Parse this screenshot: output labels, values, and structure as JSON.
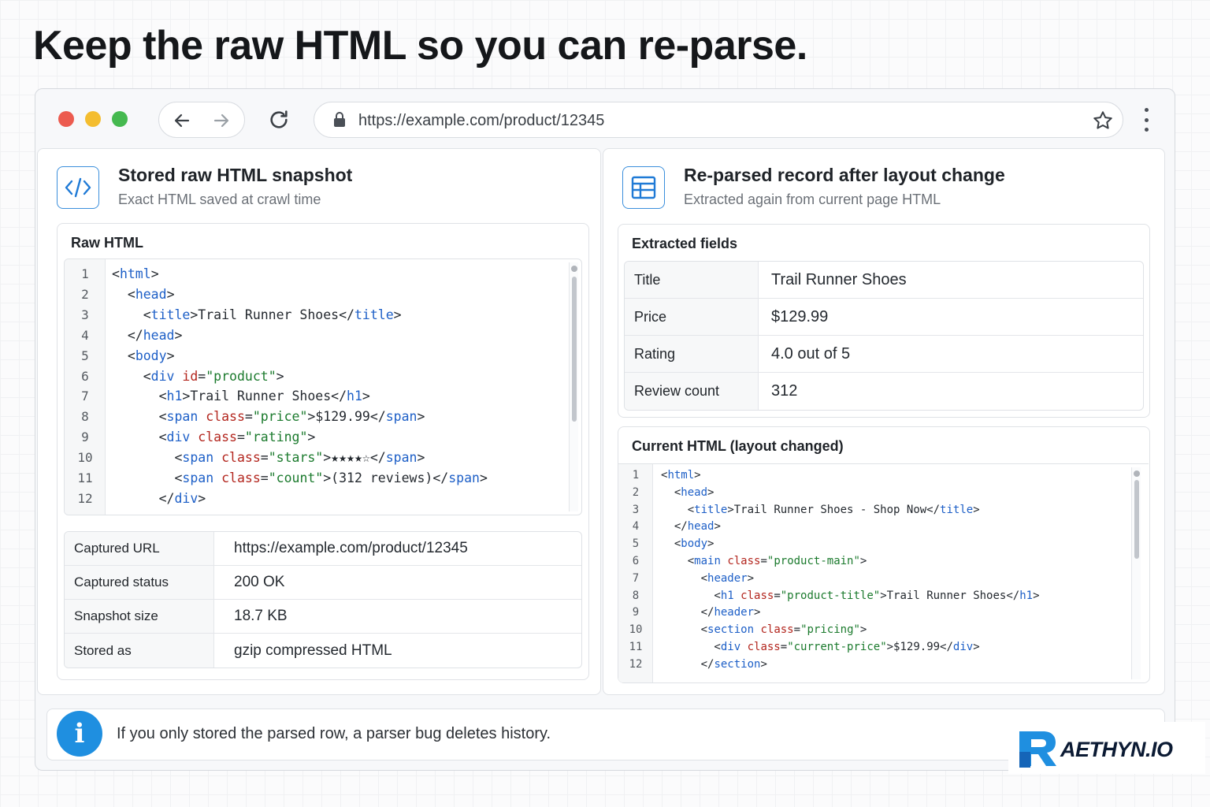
{
  "headline": "Keep the raw HTML so you can re-parse.",
  "browser": {
    "url": "https://example.com/product/12345",
    "icons": [
      "back-arrow-icon",
      "forward-arrow-icon",
      "reload-icon",
      "lock-icon",
      "star-icon",
      "more-vertical-icon"
    ]
  },
  "left_panel": {
    "title": "Stored raw HTML snapshot",
    "subtitle": "Exact HTML saved at crawl time",
    "code_title": "Raw HTML",
    "code_lines": [
      {
        "n": "1",
        "html": "<span>&lt;</span><span class=\"t\">html</span><span>&gt;</span>"
      },
      {
        "n": "2",
        "html": "  &lt;<span class=\"t\">head</span>&gt;"
      },
      {
        "n": "3",
        "html": "    &lt;<span class=\"t\">title</span>&gt;Trail Runner Shoes&lt;/<span class=\"t\">title</span>&gt;"
      },
      {
        "n": "4",
        "html": "  &lt;/<span class=\"t\">head</span>&gt;"
      },
      {
        "n": "5",
        "html": "  &lt;<span class=\"t\">body</span>&gt;"
      },
      {
        "n": "6",
        "html": "    &lt;<span class=\"t\">div</span> <span class=\"a\">id</span>=<span class=\"s\">\"product\"</span>&gt;"
      },
      {
        "n": "7",
        "html": "      &lt;<span class=\"t\">h1</span>&gt;Trail Runner Shoes&lt;/<span class=\"t\">h1</span>&gt;"
      },
      {
        "n": "8",
        "html": "      &lt;<span class=\"t\">span</span> <span class=\"a\">class</span>=<span class=\"s\">\"price\"</span>&gt;$129.99&lt;/<span class=\"t\">span</span>&gt;"
      },
      {
        "n": "9",
        "html": "      &lt;<span class=\"t\">div</span> <span class=\"a\">class</span>=<span class=\"s\">\"rating\"</span>&gt;"
      },
      {
        "n": "10",
        "html": "        &lt;<span class=\"t\">span</span> <span class=\"a\">class</span>=<span class=\"s\">\"stars\"</span>&gt;★★★★☆&lt;/<span class=\"t\">span</span>&gt;"
      },
      {
        "n": "11",
        "html": "        &lt;<span class=\"t\">span</span> <span class=\"a\">class</span>=<span class=\"s\">\"count\"</span>&gt;(312 reviews)&lt;/<span class=\"t\">span</span>&gt;"
      },
      {
        "n": "12",
        "html": "      &lt;/<span class=\"t\">div</span>&gt;"
      }
    ],
    "meta": [
      {
        "key": "Captured URL",
        "value": "https://example.com/product/12345"
      },
      {
        "key": "Captured status",
        "value": "200 OK"
      },
      {
        "key": "Snapshot size",
        "value": "18.7 KB"
      },
      {
        "key": "Stored as",
        "value": "gzip compressed HTML"
      }
    ]
  },
  "right_panel": {
    "title": "Re-parsed record after layout change",
    "subtitle": "Extracted again from current page HTML",
    "fields_title": "Extracted fields",
    "fields": [
      {
        "key": "Title",
        "value": "Trail Runner Shoes"
      },
      {
        "key": "Price",
        "value": "$129.99"
      },
      {
        "key": "Rating",
        "value": "4.0 out of 5"
      },
      {
        "key": "Review count",
        "value": "312"
      }
    ],
    "code_title": "Current HTML (layout changed)",
    "code_lines": [
      {
        "n": "1",
        "html": "&lt;<span class=\"t\">html</span>&gt;"
      },
      {
        "n": "2",
        "html": "  &lt;<span class=\"t\">head</span>&gt;"
      },
      {
        "n": "3",
        "html": "    &lt;<span class=\"t\">title</span>&gt;Trail Runner Shoes - Shop Now&lt;/<span class=\"t\">title</span>&gt;"
      },
      {
        "n": "4",
        "html": "  &lt;/<span class=\"t\">head</span>&gt;"
      },
      {
        "n": "5",
        "html": "  &lt;<span class=\"t\">body</span>&gt;"
      },
      {
        "n": "6",
        "html": "    &lt;<span class=\"t\">main</span> <span class=\"a\">class</span>=<span class=\"s\">\"product-main\"</span>&gt;"
      },
      {
        "n": "7",
        "html": "      &lt;<span class=\"t\">header</span>&gt;"
      },
      {
        "n": "8",
        "html": "        &lt;<span class=\"t\">h1</span> <span class=\"a\">class</span>=<span class=\"s\">\"product-title\"</span>&gt;Trail Runner Shoes&lt;/<span class=\"t\">h1</span>&gt;"
      },
      {
        "n": "9",
        "html": "      &lt;/<span class=\"t\">header</span>&gt;"
      },
      {
        "n": "10",
        "html": "      &lt;<span class=\"t\">section</span> <span class=\"a\">class</span>=<span class=\"s\">\"pricing\"</span>&gt;"
      },
      {
        "n": "11",
        "html": "        &lt;<span class=\"t\">div</span> <span class=\"a\">class</span>=<span class=\"s\">\"current-price\"</span>&gt;$129.99&lt;/<span class=\"t\">div</span>&gt;"
      },
      {
        "n": "12",
        "html": "      &lt;/<span class=\"t\">section</span>&gt;"
      }
    ]
  },
  "info": {
    "icon": "info-icon",
    "text": "If you only stored the parsed row, a parser bug deletes history."
  },
  "logo": {
    "text": "AETHYN.IO",
    "colors": {
      "mark": "#1f8fe0",
      "text": "#0b1a33"
    }
  }
}
